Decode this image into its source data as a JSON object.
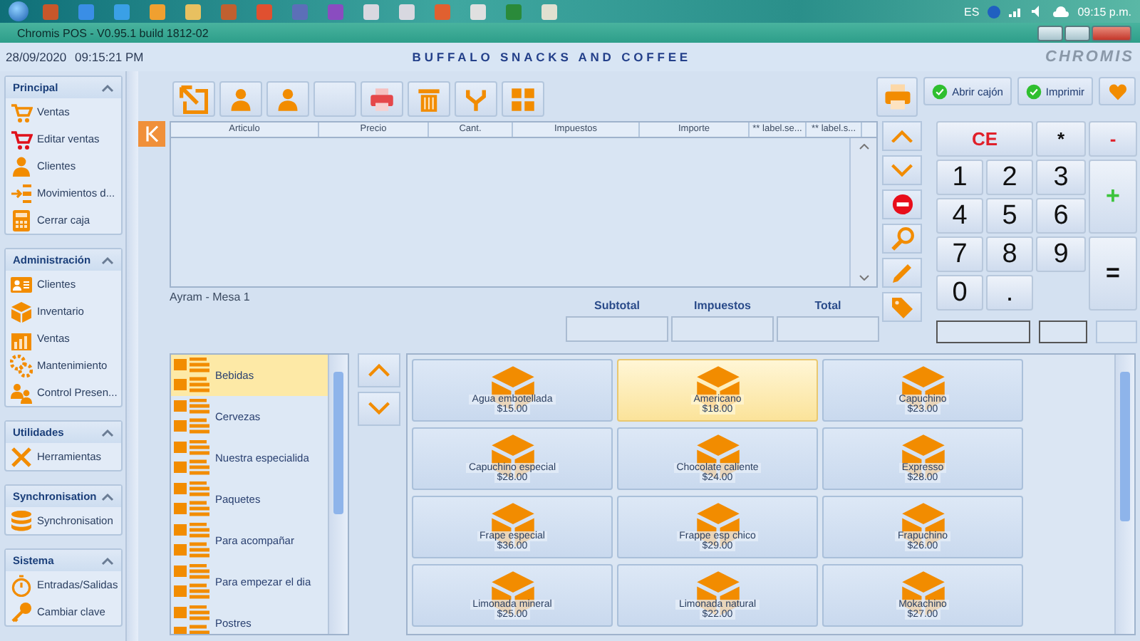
{
  "taskbar": {
    "language": "ES",
    "clock": "09:15 p.m."
  },
  "window": {
    "title": "Chromis POS - V0.95.1 build 1812-02"
  },
  "header": {
    "date": "28/09/2020",
    "time": "09:15:21 PM",
    "store_name": "BUFFALO SNACKS AND COFFEE",
    "logo": "CHROMIS"
  },
  "sidebar": {
    "sections": [
      {
        "title": "Principal",
        "expanded": true,
        "items": [
          {
            "label": "Ventas"
          },
          {
            "label": "Editar ventas"
          },
          {
            "label": "Clientes"
          },
          {
            "label": "Movimientos d..."
          },
          {
            "label": "Cerrar caja"
          }
        ]
      },
      {
        "title": "Administración",
        "expanded": true,
        "items": [
          {
            "label": "Clientes"
          },
          {
            "label": "Inventario"
          },
          {
            "label": "Ventas"
          },
          {
            "label": "Mantenimiento"
          },
          {
            "label": "Control Presen..."
          }
        ]
      },
      {
        "title": "Utilidades",
        "expanded": true,
        "items": [
          {
            "label": "Herramientas"
          }
        ]
      },
      {
        "title": "Synchronisation",
        "expanded": true,
        "items": [
          {
            "label": "Synchronisation"
          }
        ]
      },
      {
        "title": "Sistema",
        "expanded": true,
        "items": [
          {
            "label": "Entradas/Salidas"
          },
          {
            "label": "Cambiar clave"
          }
        ]
      }
    ]
  },
  "toolbar": {
    "drawer_button": "Abrir cajón",
    "print_button": "Imprimir"
  },
  "ticket": {
    "columns": [
      "Articulo",
      "Precio",
      "Cant.",
      "Impuestos",
      "Importe",
      "** label.se...",
      "** label.s..."
    ],
    "customer_table": "Ayram - Mesa 1",
    "totals": [
      {
        "label": "Subtotal"
      },
      {
        "label": "Impuestos"
      },
      {
        "label": "Total"
      }
    ]
  },
  "keypad": {
    "keys": [
      {
        "label": "CE",
        "kind": "clear"
      },
      {
        "label": "*",
        "kind": "multiply"
      },
      {
        "label": "-",
        "kind": "subtract"
      },
      {
        "label": "1",
        "kind": "digit"
      },
      {
        "label": "2",
        "kind": "digit"
      },
      {
        "label": "3",
        "kind": "digit"
      },
      {
        "label": "+",
        "kind": "add"
      },
      {
        "label": "4",
        "kind": "digit"
      },
      {
        "label": "5",
        "kind": "digit"
      },
      {
        "label": "6",
        "kind": "digit"
      },
      {
        "label": "7",
        "kind": "digit"
      },
      {
        "label": "8",
        "kind": "digit"
      },
      {
        "label": "9",
        "kind": "digit"
      },
      {
        "label": "=",
        "kind": "equals"
      },
      {
        "label": "0",
        "kind": "digit"
      },
      {
        "label": ".",
        "kind": "decimal"
      }
    ]
  },
  "categories": [
    {
      "label": "Bebidas",
      "selected": true
    },
    {
      "label": "Cervezas",
      "selected": false
    },
    {
      "label": "Nuestra especialida",
      "selected": false
    },
    {
      "label": "Paquetes",
      "selected": false
    },
    {
      "label": "Para acompañar",
      "selected": false
    },
    {
      "label": "Para empezar el dia",
      "selected": false
    },
    {
      "label": "Postres",
      "selected": false
    }
  ],
  "products": [
    {
      "name": "Agua embotellada",
      "price": "$15.00",
      "selected": false
    },
    {
      "name": "Americano",
      "price": "$18.00",
      "selected": true
    },
    {
      "name": "Capuchino",
      "price": "$23.00",
      "selected": false
    },
    {
      "name": "Capuchino especial",
      "price": "$28.00",
      "selected": false
    },
    {
      "name": "Chocolate caliente",
      "price": "$24.00",
      "selected": false
    },
    {
      "name": "Expresso",
      "price": "$28.00",
      "selected": false
    },
    {
      "name": "Frape especial",
      "price": "$36.00",
      "selected": false
    },
    {
      "name": "Frappe esp chico",
      "price": "$29.00",
      "selected": false
    },
    {
      "name": "Frapuchino",
      "price": "$26.00",
      "selected": false
    },
    {
      "name": "Limonada mineral",
      "price": "$25.00",
      "selected": false
    },
    {
      "name": "Limonada natural",
      "price": "$22.00",
      "selected": false
    },
    {
      "name": "Mokachino",
      "price": "$27.00",
      "selected": false
    }
  ]
}
